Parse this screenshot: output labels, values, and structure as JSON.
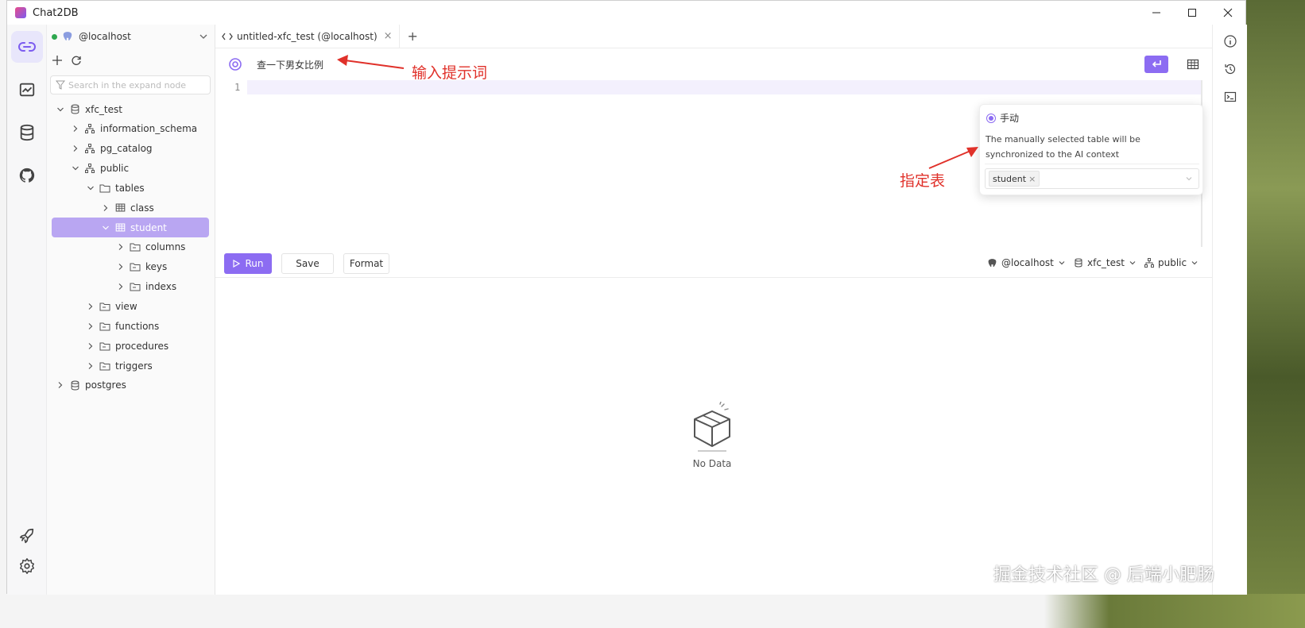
{
  "window": {
    "title": "Chat2DB",
    "controls": [
      "minimize",
      "maximize",
      "close"
    ]
  },
  "activity_bar": {
    "items": [
      {
        "icon": "connection-icon",
        "active": true
      },
      {
        "icon": "dashboard-icon",
        "active": false
      },
      {
        "icon": "database-icon",
        "active": false
      },
      {
        "icon": "github-icon",
        "active": false
      }
    ],
    "bottom": [
      {
        "icon": "rocket-icon"
      },
      {
        "icon": "gear-icon"
      }
    ]
  },
  "sidebar": {
    "connection_label": "@localhost",
    "search_placeholder": "Search in the expand node",
    "tree": [
      {
        "label": "xfc_test",
        "type": "database",
        "expanded": true,
        "depth": 0
      },
      {
        "label": "information_schema",
        "type": "schema",
        "expanded": false,
        "depth": 1
      },
      {
        "label": "pg_catalog",
        "type": "schema",
        "expanded": false,
        "depth": 1
      },
      {
        "label": "public",
        "type": "schema",
        "expanded": true,
        "depth": 1
      },
      {
        "label": "tables",
        "type": "folder",
        "expanded": true,
        "depth": 2
      },
      {
        "label": "class",
        "type": "table",
        "expanded": false,
        "depth": 3
      },
      {
        "label": "student",
        "type": "table",
        "expanded": true,
        "depth": 3,
        "selected": true
      },
      {
        "label": "columns",
        "type": "subfolder",
        "expanded": false,
        "depth": 4
      },
      {
        "label": "keys",
        "type": "subfolder",
        "expanded": false,
        "depth": 4
      },
      {
        "label": "indexs",
        "type": "subfolder",
        "expanded": false,
        "depth": 4
      },
      {
        "label": "view",
        "type": "subfolder",
        "expanded": false,
        "depth": 2
      },
      {
        "label": "functions",
        "type": "subfolder",
        "expanded": false,
        "depth": 2
      },
      {
        "label": "procedures",
        "type": "subfolder",
        "expanded": false,
        "depth": 2
      },
      {
        "label": "triggers",
        "type": "subfolder",
        "expanded": false,
        "depth": 2
      },
      {
        "label": "postgres",
        "type": "database",
        "expanded": false,
        "depth": 0
      }
    ]
  },
  "tabs": [
    {
      "label": "untitled-xfc_test (@localhost)",
      "active": true
    }
  ],
  "editor": {
    "prompt_text": "查一下男女比例",
    "line_number": "1"
  },
  "actions": {
    "run_label": "Run",
    "save_label": "Save",
    "format_label": "Format"
  },
  "context": {
    "connection": "@localhost",
    "database": "xfc_test",
    "schema": "public"
  },
  "result": {
    "empty_label": "No Data"
  },
  "table_popover": {
    "mode_label": "手动",
    "description": "The manually selected table will be synchronized to the AI context",
    "selected_tag": "student"
  },
  "annotations": {
    "prompt_note": "输入提示词",
    "table_note": "指定表"
  },
  "watermark": "掘金技术社区 @ 后端小肥肠",
  "colors": {
    "accent": "#8c6cf2",
    "selected_row": "#b9a6f2",
    "annotation": "#e0312a",
    "status_online": "#2fa84f"
  }
}
